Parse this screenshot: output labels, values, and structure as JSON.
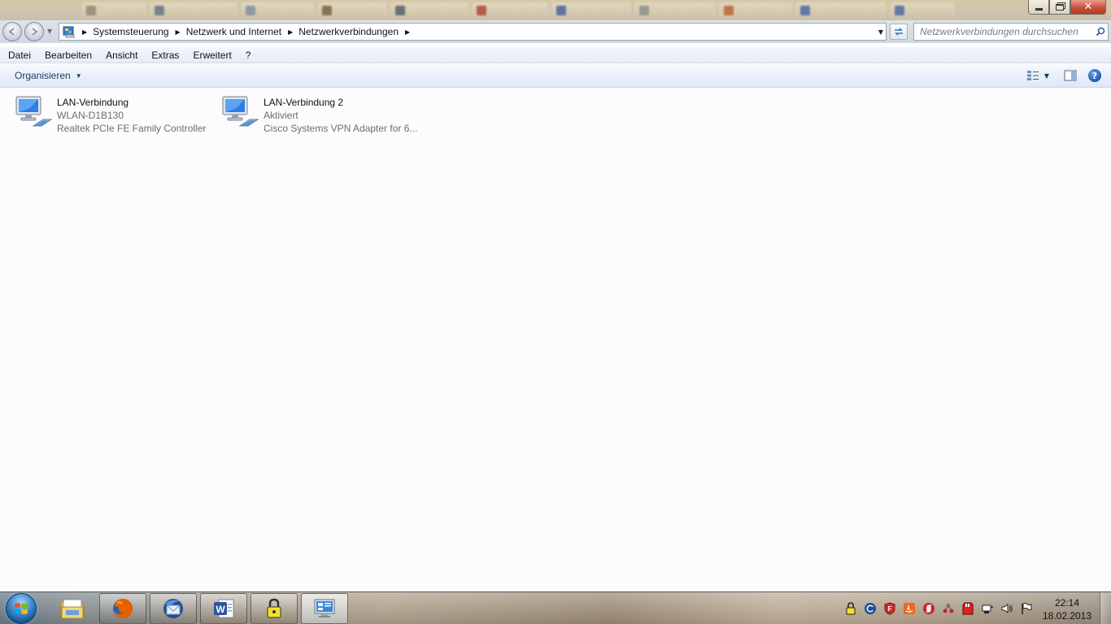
{
  "window": {
    "minimize_icon": "minimize-icon",
    "maximize_icon": "restore-icon",
    "close_glyph": "✕"
  },
  "navigation": {
    "back_icon": "back-arrow-icon",
    "forward_icon": "forward-arrow-icon",
    "breadcrumbs": [
      "Systemsteuerung",
      "Netzwerk und Internet",
      "Netzwerkverbindungen"
    ],
    "search_placeholder": "Netzwerkverbindungen durchsuchen"
  },
  "menu": {
    "items": [
      "Datei",
      "Bearbeiten",
      "Ansicht",
      "Extras",
      "Erweitert",
      "?"
    ]
  },
  "toolbar": {
    "organize_label": "Organisieren",
    "help_glyph": "?"
  },
  "connections": [
    {
      "name": "LAN-Verbindung",
      "network": "WLAN-D1B130",
      "adapter": "Realtek PCIe FE Family Controller"
    },
    {
      "name": "LAN-Verbindung 2",
      "network": "Aktiviert",
      "adapter": "Cisco Systems VPN Adapter for 6..."
    }
  ],
  "taskbar": {
    "apps": [
      "file-explorer-icon",
      "firefox-icon",
      "thunderbird-icon",
      "word-icon",
      "keepass-icon",
      "network-connections-icon"
    ],
    "clock_time": "22:14",
    "clock_date": "18.02.2013"
  },
  "colors": {
    "accent": "#1e395b",
    "close_button": "#c9503a",
    "start_orb": "#3c86c9"
  }
}
